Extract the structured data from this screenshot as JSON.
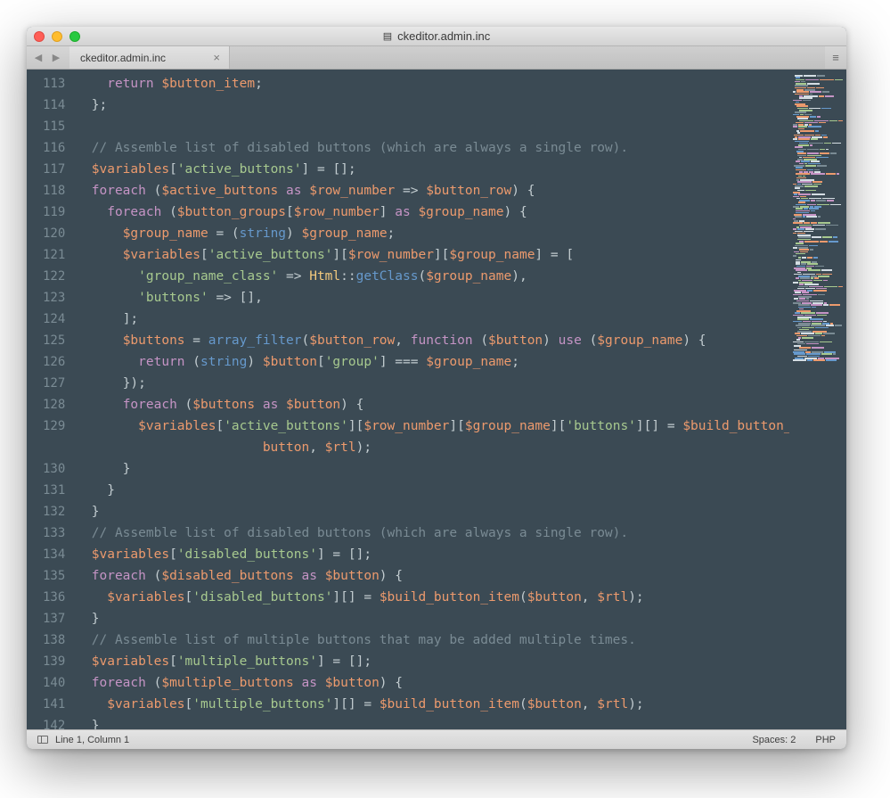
{
  "window": {
    "title": "ckeditor.admin.inc"
  },
  "tab": {
    "label": "ckeditor.admin.inc"
  },
  "gutter": {
    "start": 113,
    "end": 142
  },
  "code_lines": [
    {
      "n": 113,
      "html": "    <span class='kw'>return</span> <span class='var'>$button_item</span><span class='pun'>;</span>"
    },
    {
      "n": 114,
      "html": "  <span class='pun'>};</span>"
    },
    {
      "n": 115,
      "html": ""
    },
    {
      "n": 116,
      "html": "  <span class='com'>// Assemble list of disabled buttons (which are always a single row).</span>"
    },
    {
      "n": 117,
      "html": "  <span class='var'>$variables</span><span class='pun'>[</span><span class='str'>'active_buttons'</span><span class='pun'>]</span> <span class='op'>=</span> <span class='pun'>[];</span>"
    },
    {
      "n": 118,
      "html": "  <span class='kw'>foreach</span> <span class='pun'>(</span><span class='var'>$active_buttons</span> <span class='kw'>as</span> <span class='var'>$row_number</span> <span class='op'>=&gt;</span> <span class='var'>$button_row</span><span class='pun'>) {</span>"
    },
    {
      "n": 119,
      "html": "    <span class='kw'>foreach</span> <span class='pun'>(</span><span class='var'>$button_groups</span><span class='pun'>[</span><span class='var'>$row_number</span><span class='pun'>]</span> <span class='kw'>as</span> <span class='var'>$group_name</span><span class='pun'>) {</span>"
    },
    {
      "n": 120,
      "html": "      <span class='var'>$group_name</span> <span class='op'>=</span> <span class='pun'>(</span><span class='type'>string</span><span class='pun'>)</span> <span class='var'>$group_name</span><span class='pun'>;</span>"
    },
    {
      "n": 121,
      "html": "      <span class='var'>$variables</span><span class='pun'>[</span><span class='str'>'active_buttons'</span><span class='pun'>][</span><span class='var'>$row_number</span><span class='pun'>][</span><span class='var'>$group_name</span><span class='pun'>]</span> <span class='op'>=</span> <span class='pun'>[</span>"
    },
    {
      "n": 122,
      "html": "        <span class='str'>'group_name_class'</span> <span class='op'>=&gt;</span> <span class='cls'>Html</span><span class='pun'>::</span><span class='type'>getClass</span><span class='pun'>(</span><span class='var'>$group_name</span><span class='pun'>),</span>"
    },
    {
      "n": 123,
      "html": "        <span class='str'>'buttons'</span> <span class='op'>=&gt;</span> <span class='pun'>[],</span>"
    },
    {
      "n": 124,
      "html": "      <span class='pun'>];</span>"
    },
    {
      "n": 125,
      "html": "      <span class='var'>$buttons</span> <span class='op'>=</span> <span class='type'>array_filter</span><span class='pun'>(</span><span class='var'>$button_row</span><span class='pun'>,</span> <span class='kw'>function</span> <span class='pun'>(</span><span class='var'>$button</span><span class='pun'>)</span> <span class='kw'>use</span> <span class='pun'>(</span><span class='var'>$group_name</span><span class='pun'>) {</span>"
    },
    {
      "n": 126,
      "html": "        <span class='kw'>return</span> <span class='pun'>(</span><span class='type'>string</span><span class='pun'>)</span> <span class='var'>$button</span><span class='pun'>[</span><span class='str'>'group'</span><span class='pun'>]</span> <span class='op'>===</span> <span class='var'>$group_name</span><span class='pun'>;</span>"
    },
    {
      "n": 127,
      "html": "      <span class='pun'>});</span>"
    },
    {
      "n": 128,
      "html": "      <span class='kw'>foreach</span> <span class='pun'>(</span><span class='var'>$buttons</span> <span class='kw'>as</span> <span class='var'>$button</span><span class='pun'>) {</span>"
    },
    {
      "n": 129,
      "html": "        <span class='var'>$variables</span><span class='pun'>[</span><span class='str'>'active_buttons'</span><span class='pun'>][</span><span class='var'>$row_number</span><span class='pun'>][</span><span class='var'>$group_name</span><span class='pun'>][</span><span class='str'>'buttons'</span><span class='pun'>][]</span> <span class='op'>=</span> <span class='var'>$build_button_item</span><span class='pun'>(</span><span class='var'>$</span>\n            <span class='var'>button</span><span class='pun'>,</span> <span class='var'>$rtl</span><span class='pun'>);</span>"
    },
    {
      "n": 130,
      "html": "      <span class='pun'>}</span>"
    },
    {
      "n": 131,
      "html": "    <span class='pun'>}</span>"
    },
    {
      "n": 132,
      "html": "  <span class='pun'>}</span>"
    },
    {
      "n": 133,
      "html": "  <span class='com'>// Assemble list of disabled buttons (which are always a single row).</span>"
    },
    {
      "n": 134,
      "html": "  <span class='var'>$variables</span><span class='pun'>[</span><span class='str'>'disabled_buttons'</span><span class='pun'>]</span> <span class='op'>=</span> <span class='pun'>[];</span>"
    },
    {
      "n": 135,
      "html": "  <span class='kw'>foreach</span> <span class='pun'>(</span><span class='var'>$disabled_buttons</span> <span class='kw'>as</span> <span class='var'>$button</span><span class='pun'>) {</span>"
    },
    {
      "n": 136,
      "html": "    <span class='var'>$variables</span><span class='pun'>[</span><span class='str'>'disabled_buttons'</span><span class='pun'>][]</span> <span class='op'>=</span> <span class='var'>$build_button_item</span><span class='pun'>(</span><span class='var'>$button</span><span class='pun'>,</span> <span class='var'>$rtl</span><span class='pun'>);</span>"
    },
    {
      "n": 137,
      "html": "  <span class='pun'>}</span>"
    },
    {
      "n": 138,
      "html": "  <span class='com'>// Assemble list of multiple buttons that may be added multiple times.</span>"
    },
    {
      "n": 139,
      "html": "  <span class='var'>$variables</span><span class='pun'>[</span><span class='str'>'multiple_buttons'</span><span class='pun'>]</span> <span class='op'>=</span> <span class='pun'>[];</span>"
    },
    {
      "n": 140,
      "html": "  <span class='kw'>foreach</span> <span class='pun'>(</span><span class='var'>$multiple_buttons</span> <span class='kw'>as</span> <span class='var'>$button</span><span class='pun'>) {</span>"
    },
    {
      "n": 141,
      "html": "    <span class='var'>$variables</span><span class='pun'>[</span><span class='str'>'multiple_buttons'</span><span class='pun'>][]</span> <span class='op'>=</span> <span class='var'>$build_button_item</span><span class='pun'>(</span><span class='var'>$button</span><span class='pun'>,</span> <span class='var'>$rtl</span><span class='pun'>);</span>"
    },
    {
      "n": 142,
      "html": "  <span class='pun'>}</span>"
    }
  ],
  "status": {
    "position": "Line 1, Column 1",
    "spaces": "Spaces: 2",
    "syntax": "PHP"
  }
}
